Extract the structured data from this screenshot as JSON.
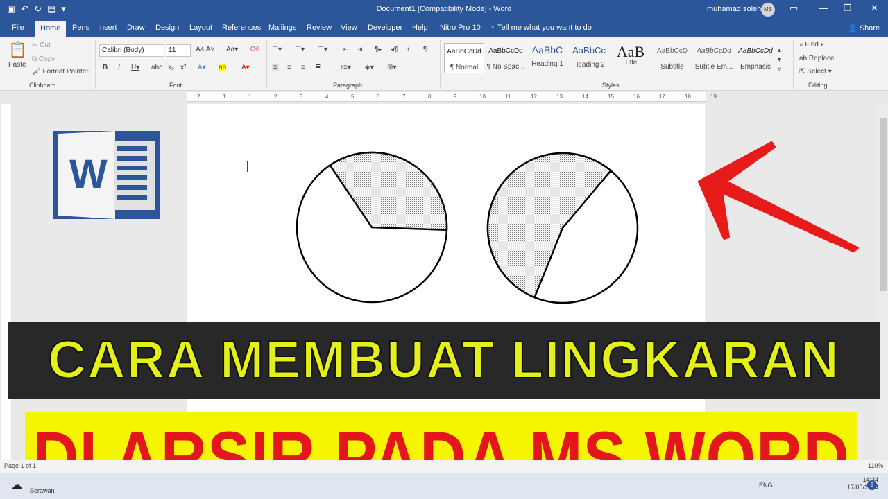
{
  "window": {
    "title": "Document1 [Compatibility Mode]  -  Word",
    "user_name": "muhamad soleh",
    "user_initials": "MS"
  },
  "tabs": [
    "File",
    "Home",
    "Pens",
    "Insert",
    "Draw",
    "Design",
    "Layout",
    "References",
    "Mailings",
    "Review",
    "View",
    "Developer",
    "Help",
    "Nitro Pro 10"
  ],
  "active_tab": "Home",
  "tell_me": "Tell me what you want to do",
  "share": "Share",
  "clipboard": {
    "paste": "Paste",
    "cut": "Cut",
    "copy": "Copy",
    "format_painter": "Format Painter",
    "label": "Clipboard"
  },
  "font": {
    "family": "Calibri (Body)",
    "size": "11",
    "label": "Font"
  },
  "paragraph": {
    "label": "Paragraph"
  },
  "styles": {
    "label": "Styles",
    "items": [
      {
        "sample": "AaBbCcDd",
        "name": "¶ Normal"
      },
      {
        "sample": "AaBbCcDd",
        "name": "¶ No Spac..."
      },
      {
        "sample": "AaBbC",
        "name": "Heading 1"
      },
      {
        "sample": "AaBbCc",
        "name": "Heading 2"
      },
      {
        "sample": "AaB",
        "name": "Title"
      },
      {
        "sample": "AaBbCcD",
        "name": "Subtitle"
      },
      {
        "sample": "AaBbCcDd",
        "name": "Subtle Em..."
      },
      {
        "sample": "AaBbCcDd",
        "name": "Emphasis"
      }
    ]
  },
  "editing": {
    "find": "Find",
    "replace": "Replace",
    "select": "Select",
    "label": "Editing"
  },
  "ruler_numbers": [
    "2",
    "1",
    "1",
    "2",
    "3",
    "4",
    "5",
    "6",
    "7",
    "8",
    "9",
    "10",
    "11",
    "12",
    "13",
    "14",
    "15",
    "16",
    "17",
    "18",
    "19"
  ],
  "pies": [
    {
      "shaded_fraction": 0.35
    },
    {
      "shaded_fraction": 0.55
    }
  ],
  "banner_top": "CARA MEMBUAT LINGKARAN",
  "banner_bottom": "DI ARSIR PADA MS WORD",
  "status": {
    "page": "Page 1 of 1",
    "zoom": "110%"
  },
  "taskbar": {
    "weather": "Berawan",
    "lang": "ENG",
    "time": "14:34",
    "date": "17/05/2024",
    "notifications": "9"
  },
  "colors": {
    "word_blue": "#2b579a",
    "banner_yellow_text": "#e4f01a",
    "banner_red_text": "#e2161c",
    "arrow_red": "#e81b1b"
  }
}
